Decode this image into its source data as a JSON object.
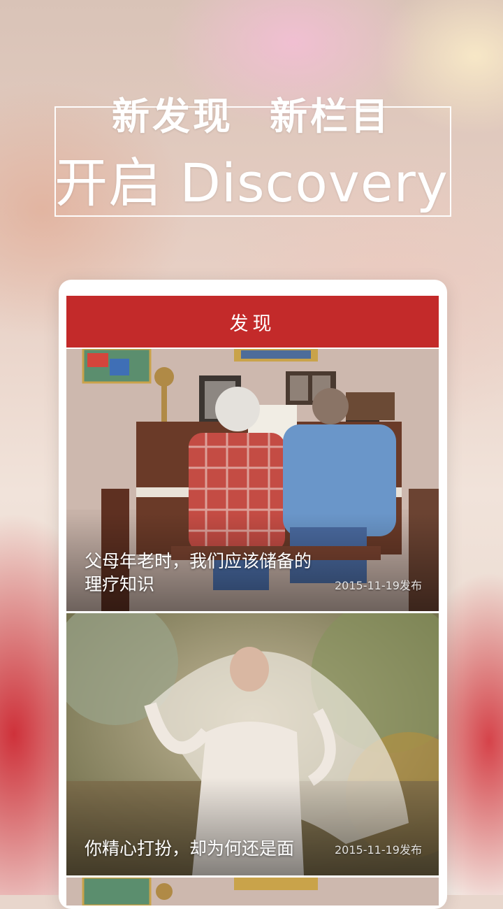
{
  "promo": {
    "line1_a": "新发现",
    "line1_b": "新栏目",
    "line2": "开启 Discovery"
  },
  "app": {
    "header_title": "发现",
    "accent_color": "#c32a2a"
  },
  "feed": {
    "items": [
      {
        "title": "父母年老时，我们应该储备的理疗知识",
        "date": "2015-11-19发布"
      },
      {
        "title": "你精心打扮，却为何还是面",
        "date": "2015-11-19发布"
      }
    ]
  }
}
